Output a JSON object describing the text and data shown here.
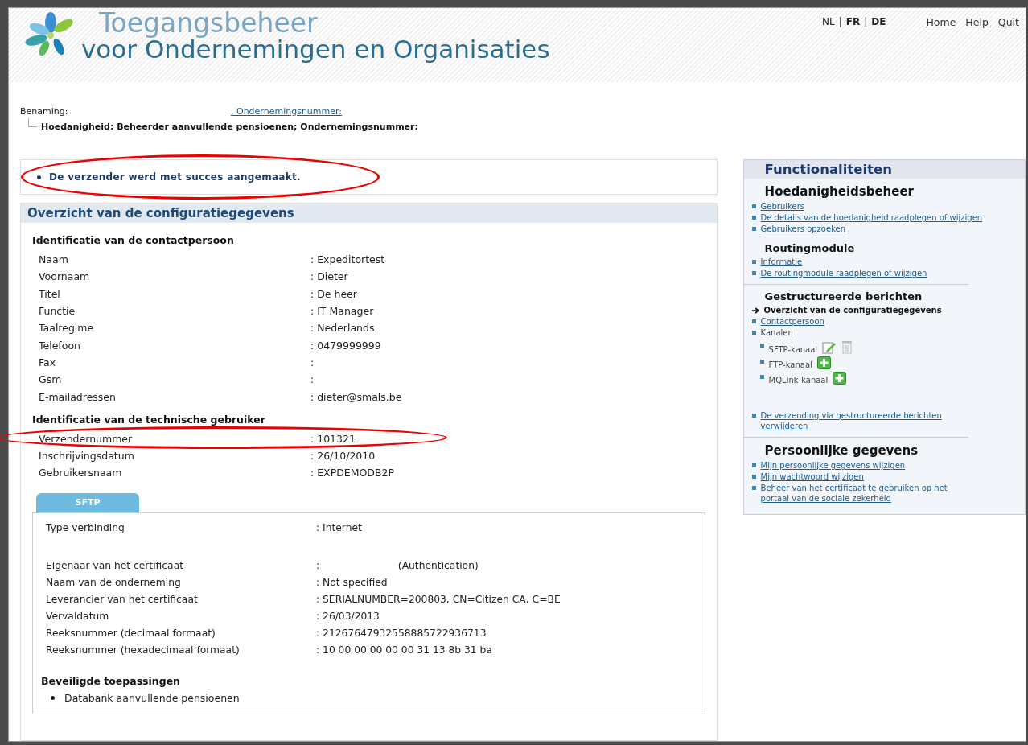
{
  "header": {
    "title_line_1": "Toegangsbeheer",
    "title_line_2": "voor Ondernemingen en Organisaties",
    "languages": [
      {
        "label": "NL",
        "selected": true
      },
      {
        "label": "FR",
        "selected": false
      },
      {
        "label": "DE",
        "selected": false
      }
    ],
    "separator": "|",
    "links": [
      "Home",
      "Help",
      "Quit"
    ]
  },
  "context": {
    "benaming_label": "Benaming:",
    "benaming_link": ", Ondernemingsnummer:",
    "hoedanigheid": "Hoedanigheid: Beheerder aanvullende pensioenen; Ondernemingsnummer:"
  },
  "message": "De verzender werd met succes aangemaakt.",
  "overview": {
    "title": "Overzicht van de configuratiegegevens",
    "groups": [
      {
        "heading": "Identificatie van de contactpersoon",
        "rows": [
          {
            "label": "Naam",
            "value": ": Expeditortest"
          },
          {
            "label": "Voornaam",
            "value": ": Dieter"
          },
          {
            "label": "Titel",
            "value": ": De heer"
          },
          {
            "label": "Functie",
            "value": ": IT Manager"
          },
          {
            "label": "Taalregime",
            "value": ": Nederlands"
          },
          {
            "label": "Telefoon",
            "value": ": 0479999999"
          },
          {
            "label": "Fax",
            "value": ":"
          },
          {
            "label": "Gsm",
            "value": ":"
          },
          {
            "label": "E-mailadressen",
            "value": ": dieter@smals.be"
          }
        ]
      },
      {
        "heading": "Identificatie van de technische gebruiker",
        "rows": [
          {
            "label": "Verzendernummer",
            "value": ": 101321"
          },
          {
            "label": "Inschrijvingsdatum",
            "value": ": 26/10/2010"
          },
          {
            "label": "Gebruikersnaam",
            "value": ": EXPDEMODB2P"
          }
        ]
      }
    ],
    "tabs": [
      {
        "label": "SFTP",
        "selected": true
      }
    ],
    "channel_rows": [
      {
        "label": "Type verbinding",
        "value": ": Internet"
      },
      {
        "label": "Eigenaar van het certificaat",
        "value": ":                         (Authentication)"
      },
      {
        "label": "Naam van de onderneming",
        "value": ": Not specified"
      },
      {
        "label": "Leverancier van het certificaat",
        "value": ": SERIALNUMBER=200803, CN=Citizen CA, C=BE"
      },
      {
        "label": "Vervaldatum",
        "value": ": 26/03/2013"
      },
      {
        "label": "Reeksnummer (decimaal formaat)",
        "value": ": 21267647932558885722936713"
      },
      {
        "label": "Reeksnummer (hexadecimaal formaat)",
        "value": ": 10 00 00 00 00 00 31 13 8b 31 ba"
      }
    ],
    "applications_heading": "Beveiligde toepassingen",
    "applications": [
      "Databank aanvullende pensioenen"
    ]
  },
  "sidebar": {
    "title": "Functionaliteiten",
    "sections": [
      {
        "title": "Hoedanigheidsbeheer",
        "items": [
          {
            "label": "Gebruikers",
            "kind": "link",
            "selected": false
          },
          {
            "label": "De details van de hoedanigheid raadplegen of wijzigen",
            "kind": "link",
            "selected": false
          },
          {
            "label": "Gebruikers opzoeken",
            "kind": "link",
            "selected": false
          }
        ]
      },
      {
        "title": "Routingmodule",
        "items": [
          {
            "label": "Informatie",
            "kind": "link",
            "selected": false
          },
          {
            "label": "De routingmodule raadplegen of wijzigen",
            "kind": "link",
            "selected": false
          }
        ]
      },
      {
        "title": "Gestructureerde berichten",
        "items": [
          {
            "label": "Overzicht van de configuratiegegevens",
            "kind": "link",
            "selected": true
          },
          {
            "label": "Contactpersoon",
            "kind": "link",
            "selected": false
          },
          {
            "label": "Kanalen",
            "kind": "plain",
            "selected": false,
            "children": [
              {
                "label": "SFTP-kanaal",
                "kind": "configured"
              },
              {
                "label": "FTP-kanaal",
                "kind": "available"
              },
              {
                "label": "MQLink-kanaal",
                "kind": "available"
              }
            ]
          },
          {
            "label": "De verzending via gestructureerde berichten verwijderen",
            "kind": "link",
            "selected": false
          }
        ]
      },
      {
        "title": "Persoonlijke gegevens",
        "items": [
          {
            "label": "Mijn persoonlijke gegevens wijzigen",
            "kind": "link",
            "selected": false
          },
          {
            "label": "Mijn wachtwoord wijzigen",
            "kind": "link",
            "selected": false
          },
          {
            "label": "Beheer van het certificaat te gebruiken op het portaal van de sociale zekerheid",
            "kind": "link",
            "selected": false
          }
        ]
      }
    ]
  }
}
